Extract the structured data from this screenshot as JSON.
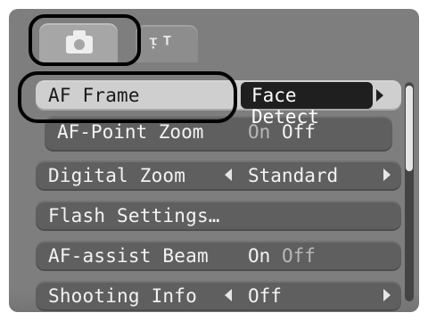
{
  "tabs": {
    "camera_icon": "camera-icon",
    "setup_icon": "tools-icon"
  },
  "menu": {
    "items": [
      {
        "label": "AF Frame",
        "value": "Face Detect"
      },
      {
        "label": "AF-Point Zoom",
        "value_on": "On",
        "value_off": "Off"
      },
      {
        "label": "Digital Zoom",
        "value": "Standard"
      },
      {
        "label": "Flash Settings…",
        "value": ""
      },
      {
        "label": "AF-assist Beam",
        "value_on": "On",
        "value_off": "Off"
      },
      {
        "label": "Shooting Info",
        "value": "Off"
      }
    ]
  },
  "colors": {
    "background": "#7e7e7e",
    "row": "#5f5f5f",
    "selected_row": "#cfcfcf",
    "selected_value_chip": "#1f1f1f",
    "text": "#f3f3f3",
    "dim_text": "#b7b7b7",
    "outline": "#000000"
  }
}
